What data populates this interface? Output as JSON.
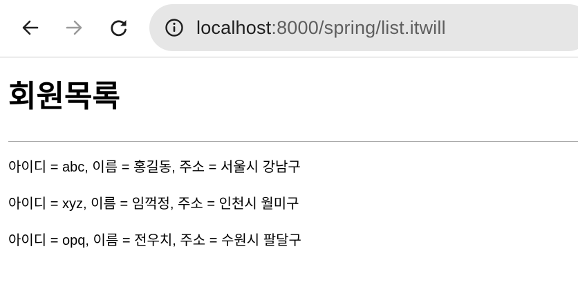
{
  "browser": {
    "url_host": "localhost",
    "url_rest": ":8000/spring/list.itwill",
    "back_icon": "arrow-left-icon",
    "forward_icon": "arrow-right-icon",
    "reload_icon": "reload-icon",
    "site_info_icon": "info-circle-icon"
  },
  "page": {
    "title": "회원목록",
    "members": [
      {
        "text": "아이디 = abc, 이름 = 홍길동, 주소 = 서울시 강남구"
      },
      {
        "text": "아이디 = xyz, 이름 = 임꺽정, 주소 = 인천시 월미구"
      },
      {
        "text": "아이디 = opq, 이름 = 전우치, 주소 = 수원시 팔달구"
      }
    ]
  },
  "colors": {
    "toolbar_bg": "#ffffff",
    "address_bar_bg": "#e6e6e6",
    "icon_active": "#1f1f1f",
    "icon_disabled": "#9a9a9a",
    "divider": "#a8a8a8"
  }
}
